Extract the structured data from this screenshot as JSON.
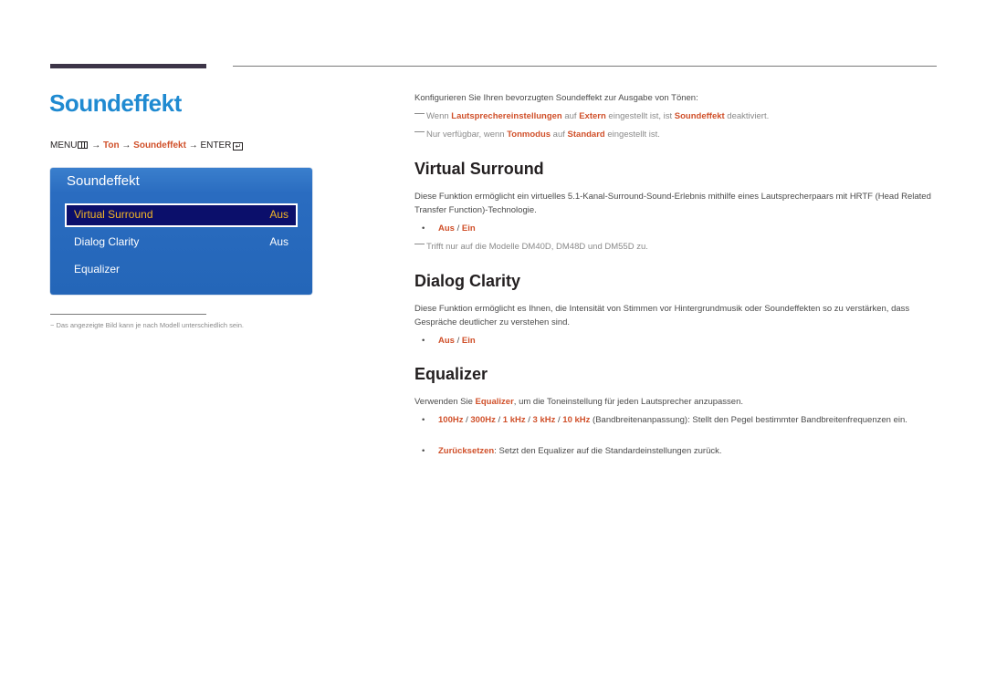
{
  "header": {
    "title": "Soundeffekt"
  },
  "menu_path": {
    "menu": "MENU",
    "menu_icon": "menu-grid-icon",
    "arrow": "→",
    "ton": "Ton",
    "soundeffekt": "Soundeffekt",
    "enter": "ENTER",
    "enter_icon": "enter-icon",
    "enter_glyph": "↵"
  },
  "osd": {
    "title": "Soundeffekt",
    "items": [
      {
        "label": "Virtual Surround",
        "value": "Aus",
        "selected": true
      },
      {
        "label": "Dialog Clarity",
        "value": "Aus",
        "selected": false
      },
      {
        "label": "Equalizer",
        "value": "",
        "selected": false
      }
    ]
  },
  "footnote": "−  Das angezeigte Bild kann je nach Modell unterschiedlich sein.",
  "intro": {
    "text": "Konfigurieren Sie Ihren bevorzugten Soundeffekt zur Ausgabe von Tönen:",
    "note1": {
      "a": "Wenn ",
      "b": "Lautsprechereinstellungen",
      "c": " auf ",
      "d": "Extern",
      "e": " eingestellt ist, ist ",
      "f": "Soundeffekt",
      "g": " deaktiviert."
    },
    "note2": {
      "a": "Nur verfügbar, wenn ",
      "b": "Tonmodus",
      "c": " auf ",
      "d": "Standard",
      "e": " eingestellt ist."
    }
  },
  "sections": {
    "virtual_surround": {
      "heading": "Virtual Surround",
      "body": "Diese Funktion ermöglicht ein virtuelles 5.1-Kanal-Surround-Sound-Erlebnis mithilfe eines Lautsprecherpaars mit HRTF (Head Related Transfer Function)-Technologie.",
      "opt_off": "Aus",
      "sep": " / ",
      "opt_on": "Ein",
      "note": "Trifft nur auf die Modelle DM40D, DM48D und DM55D zu."
    },
    "dialog_clarity": {
      "heading": "Dialog Clarity",
      "body": "Diese Funktion ermöglicht es Ihnen, die Intensität von Stimmen vor Hintergrundmusik oder Soundeffekten so zu verstärken, dass Gespräche deutlicher zu verstehen sind.",
      "opt_off": "Aus",
      "sep": " / ",
      "opt_on": "Ein"
    },
    "equalizer": {
      "heading": "Equalizer",
      "body_a": "Verwenden Sie ",
      "body_b": "Equalizer",
      "body_c": ", um die Toneinstellung für jeden Lautsprecher anzupassen.",
      "bands": [
        "100Hz",
        "300Hz",
        "1 kHz",
        "3 kHz",
        "10 kHz"
      ],
      "band_sep": " / ",
      "bands_desc": " (Bandbreitenanpassung): Stellt den Pegel bestimmter Bandbreitenfrequenzen ein.",
      "reset_label": "Zurücksetzen",
      "reset_desc": ": Setzt den Equalizer auf die Standardeinstellungen zurück."
    }
  },
  "colors": {
    "title_blue": "#1f8ad1",
    "highlight": "#d0502a",
    "osd_blue": "#2466b8",
    "osd_selected_bg": "#0b0f6b",
    "osd_selected_text": "#f2b526"
  }
}
